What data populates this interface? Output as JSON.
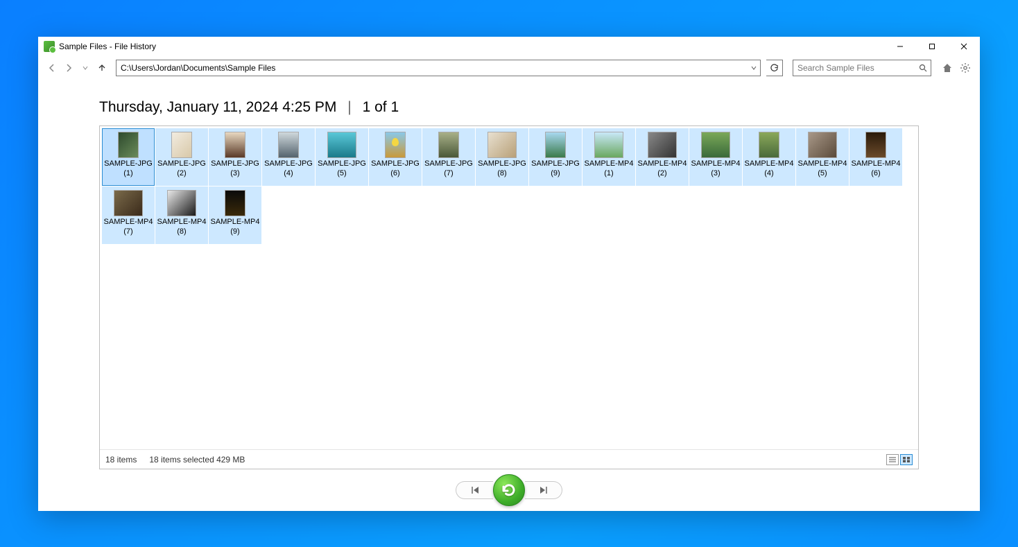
{
  "window": {
    "title": "Sample Files - File History"
  },
  "nav": {
    "path": "C:\\Users\\Jordan\\Documents\\Sample Files",
    "search_placeholder": "Search Sample Files"
  },
  "version": {
    "timestamp": "Thursday, January 11, 2024 4:25 PM",
    "position": "1 of 1"
  },
  "files": [
    {
      "name": "SAMPLE-JPG (1)",
      "orient": "portrait",
      "thumb": "t1"
    },
    {
      "name": "SAMPLE-JPG (2)",
      "orient": "portrait",
      "thumb": "t2"
    },
    {
      "name": "SAMPLE-JPG (3)",
      "orient": "portrait",
      "thumb": "t3"
    },
    {
      "name": "SAMPLE-JPG (4)",
      "orient": "portrait",
      "thumb": "t4"
    },
    {
      "name": "SAMPLE-JPG (5)",
      "orient": "land",
      "thumb": "t5"
    },
    {
      "name": "SAMPLE-JPG (6)",
      "orient": "portrait",
      "thumb": "t6"
    },
    {
      "name": "SAMPLE-JPG (7)",
      "orient": "portrait",
      "thumb": "t7"
    },
    {
      "name": "SAMPLE-JPG (8)",
      "orient": "land",
      "thumb": "t8"
    },
    {
      "name": "SAMPLE-JPG (9)",
      "orient": "portrait",
      "thumb": "t9"
    },
    {
      "name": "SAMPLE-MP4 (1)",
      "orient": "land",
      "thumb": "t10"
    },
    {
      "name": "SAMPLE-MP4 (2)",
      "orient": "land",
      "thumb": "t11"
    },
    {
      "name": "SAMPLE-MP4 (3)",
      "orient": "land",
      "thumb": "t12"
    },
    {
      "name": "SAMPLE-MP4 (4)",
      "orient": "portrait",
      "thumb": "t13"
    },
    {
      "name": "SAMPLE-MP4 (5)",
      "orient": "land",
      "thumb": "t14"
    },
    {
      "name": "SAMPLE-MP4 (6)",
      "orient": "portrait",
      "thumb": "t15"
    },
    {
      "name": "SAMPLE-MP4 (7)",
      "orient": "land",
      "thumb": "t16"
    },
    {
      "name": "SAMPLE-MP4 (8)",
      "orient": "land",
      "thumb": "t17"
    },
    {
      "name": "SAMPLE-MP4 (9)",
      "orient": "portrait",
      "thumb": "t18"
    }
  ],
  "status": {
    "count": "18 items",
    "selection": "18 items selected  429 MB"
  }
}
